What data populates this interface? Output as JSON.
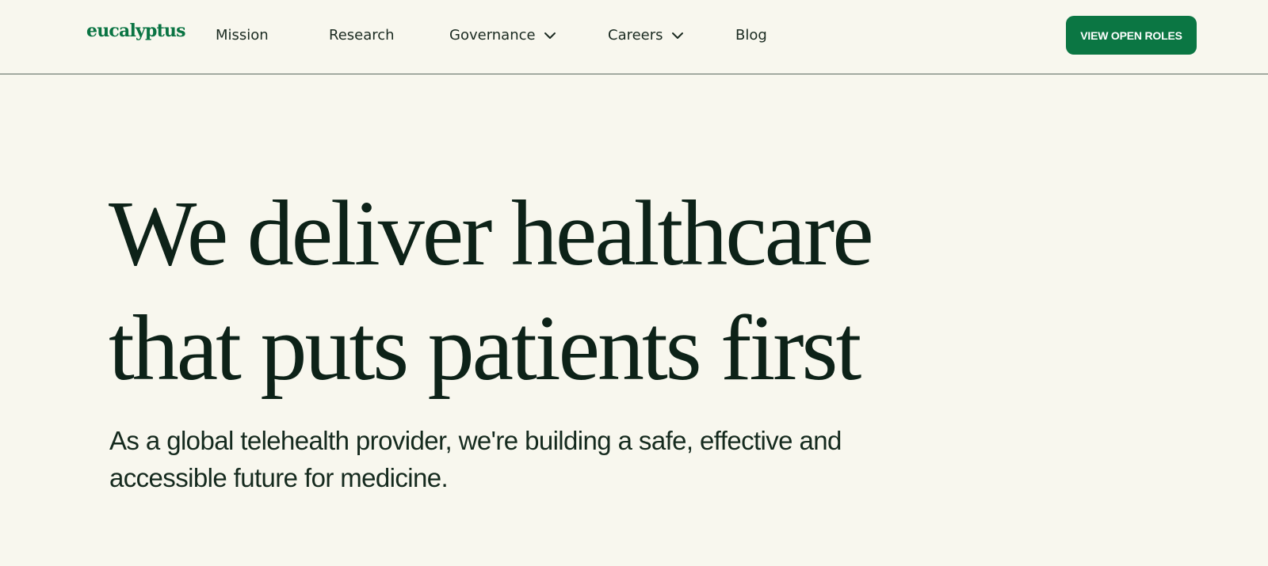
{
  "header": {
    "logo": "eucalyptus",
    "nav": {
      "mission": "Mission",
      "research": "Research",
      "governance": "Governance",
      "careers": "Careers",
      "blog": "Blog"
    },
    "cta_label": "VIEW OPEN ROLES"
  },
  "hero": {
    "title_line1": "We deliver healthcare",
    "title_line2": "that puts patients first",
    "subtitle_line1": "As a global telehealth provider, we're building a safe, effective and",
    "subtitle_line2": "accessible future for medicine."
  },
  "icons": {
    "governance_dropdown": "chevron-down-icon",
    "careers_dropdown": "chevron-down-icon"
  },
  "colors": {
    "background": "#f8f7ee",
    "brand_green": "#0b7643",
    "text_dark": "#0d2218"
  }
}
